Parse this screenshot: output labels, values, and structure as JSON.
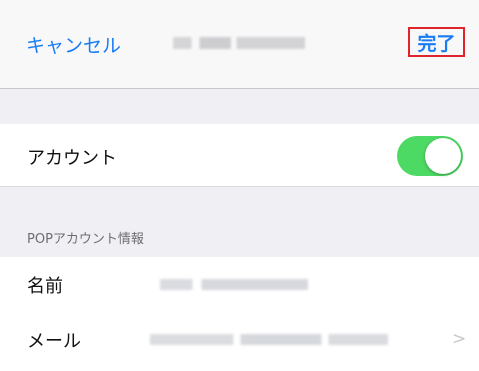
{
  "nav": {
    "cancel_label": "キャンセル",
    "done_label": "完了"
  },
  "rows": {
    "account_label": "アカウント",
    "account_toggle_on": true,
    "section_header": "POPアカウント情報",
    "name_label": "名前",
    "mail_label": "メール"
  },
  "icons": {
    "chevron": "chevron-right-icon"
  },
  "colors": {
    "accent": "#1a7cf5",
    "toggle_on": "#4cd964",
    "highlight_box": "#e0242b",
    "background": "#efeff4"
  }
}
